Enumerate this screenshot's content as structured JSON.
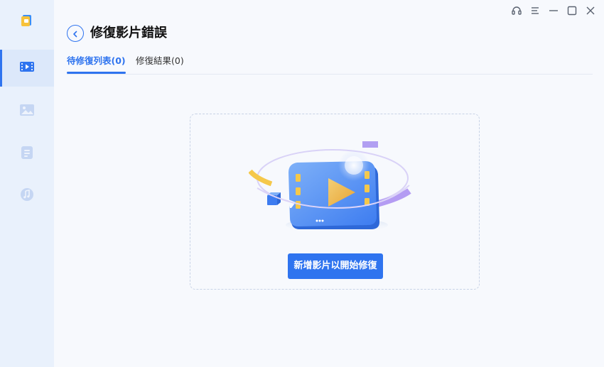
{
  "window": {
    "controls": [
      "headset-icon",
      "menu-icon",
      "minimize-icon",
      "maximize-icon",
      "close-icon"
    ]
  },
  "sidebar": {
    "items": [
      {
        "name": "video-repair",
        "icon": "video-icon",
        "active": true
      },
      {
        "name": "photo-repair",
        "icon": "image-icon",
        "active": false
      },
      {
        "name": "file-repair",
        "icon": "document-icon",
        "active": false
      },
      {
        "name": "audio-repair",
        "icon": "music-icon",
        "active": false
      }
    ]
  },
  "header": {
    "title": "修復影片錯誤"
  },
  "tabs": [
    {
      "label": "待修復列表(0)",
      "active": true
    },
    {
      "label": "修復結果(0)",
      "active": false
    }
  ],
  "main": {
    "add_button_label": "新增影片以開始修復"
  },
  "colors": {
    "accent": "#2f74ef",
    "sidebar_bg": "#e9f1fc",
    "page_bg": "#f7f9fd"
  }
}
